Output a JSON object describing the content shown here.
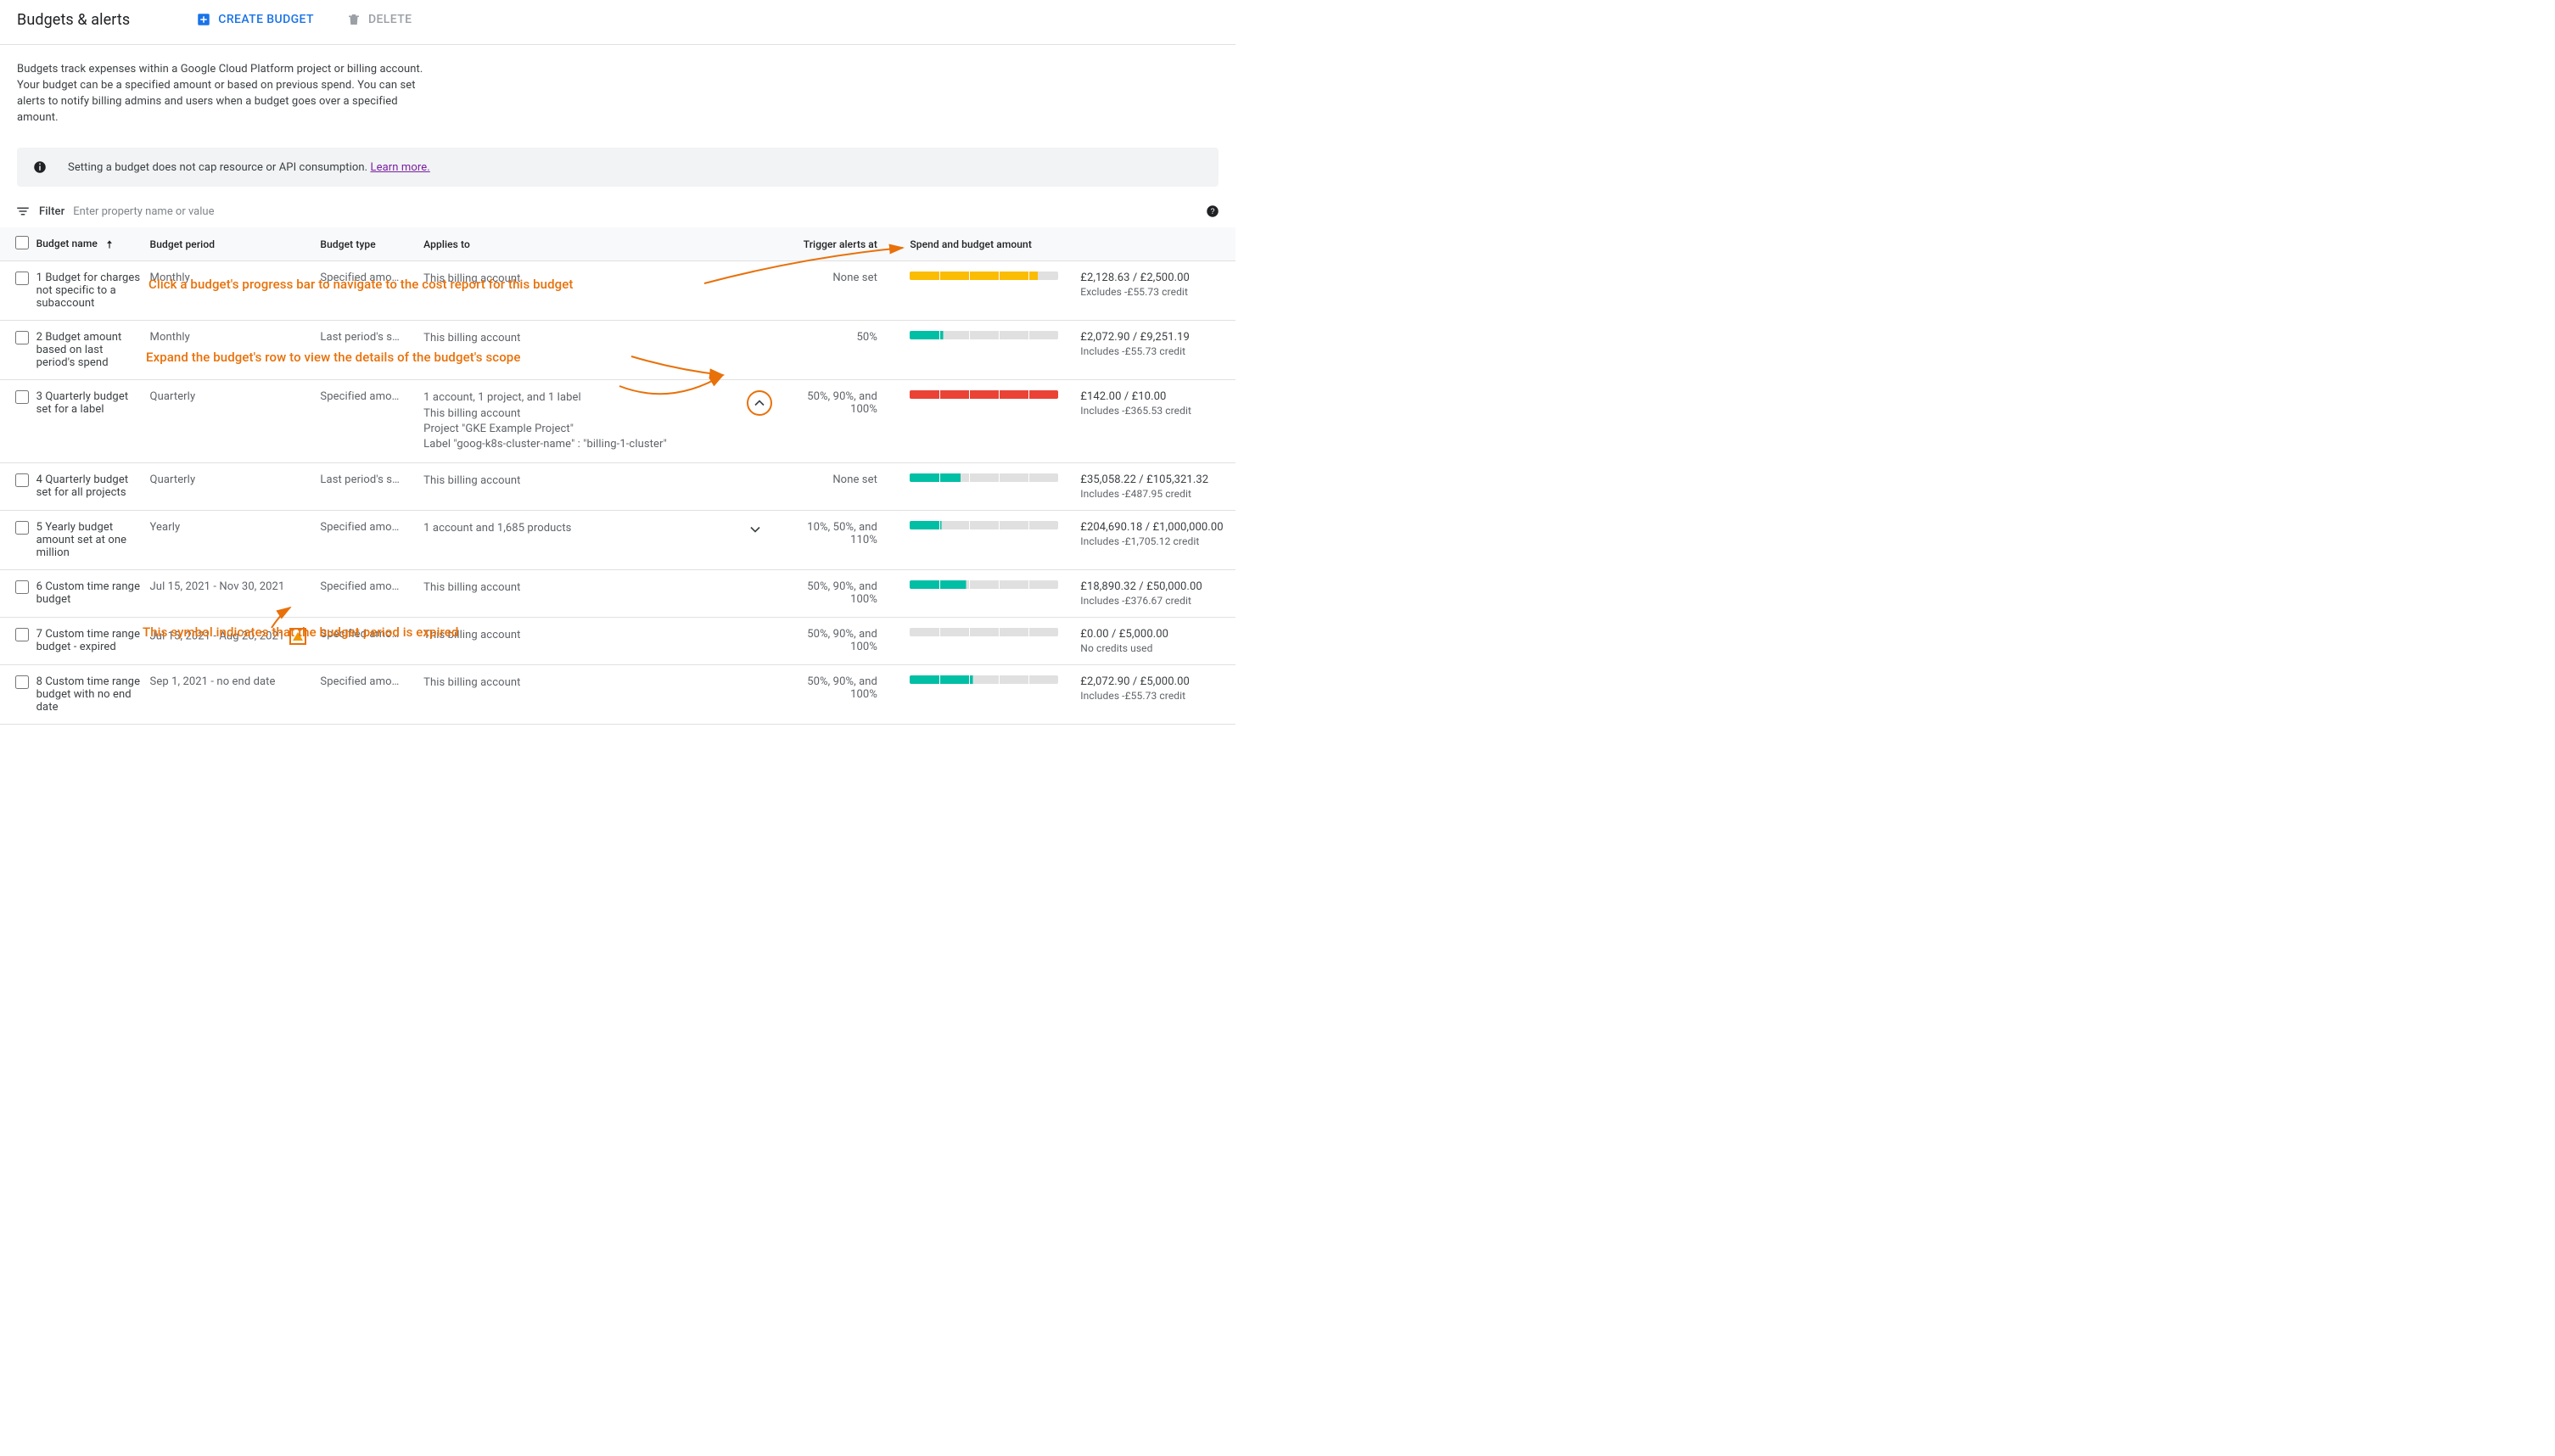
{
  "header": {
    "title": "Budgets & alerts",
    "create_label": "Create budget",
    "delete_label": "Delete"
  },
  "intro": "Budgets track expenses within a Google Cloud Platform project or billing account. Your budget can be a specified amount or based on previous spend. You can set alerts to notify billing admins and users when a budget goes over a specified amount.",
  "notice": {
    "text": "Setting a budget does not cap resource or API consumption. ",
    "link_label": "Learn more."
  },
  "filter": {
    "label": "Filter",
    "placeholder": "Enter property name or value"
  },
  "columns": {
    "name": "Budget name",
    "period": "Budget period",
    "type": "Budget type",
    "applies": "Applies to",
    "trigger": "Trigger alerts at",
    "spend": "Spend and budget amount"
  },
  "annotations": {
    "a1": "Click a budget's progress bar to navigate to the cost report for this budget",
    "a2": "Expand the budget's row to view the details of the budget's scope",
    "a3": "This symbol indicates that the budget period is expired"
  },
  "rows": [
    {
      "idx": "1",
      "name": "Budget for charges not specific to a subaccount",
      "period": "Monthly",
      "type": "Specified amo…",
      "applies": [
        "This billing account"
      ],
      "trigger": "None set",
      "expand": "none",
      "progress": {
        "segments": 5,
        "filled": 4,
        "partial": 0.3,
        "color": "fill-orange"
      },
      "amount": "£2,128.63 / £2,500.00",
      "sub": "Excludes -£55.73 credit"
    },
    {
      "idx": "2",
      "name": "Budget amount based on last period's spend",
      "period": "Monthly",
      "type": "Last period's s…",
      "applies": [
        "This billing account"
      ],
      "trigger": "50%",
      "expand": "none",
      "progress": {
        "segments": 5,
        "filled": 1,
        "partial": 0.1,
        "color": "fill-teal"
      },
      "amount": "£2,072.90 / £9,251.19",
      "sub": "Includes -£55.73 credit"
    },
    {
      "idx": "3",
      "name": "Quarterly budget set for a label",
      "period": "Quarterly",
      "type": "Specified amo…",
      "applies": [
        "1 account, 1 project, and 1 label",
        "This billing account",
        "Project \"GKE Example Project\"",
        "Label \"goog-k8s-cluster-name\" : \"billing-1-cluster\""
      ],
      "trigger": "50%, 90%, and 100%",
      "expand": "up-highlight",
      "progress": {
        "segments": 5,
        "filled": 5,
        "partial": 0,
        "color": "fill-red"
      },
      "amount": "£142.00 / £10.00",
      "sub": "Includes -£365.53 credit"
    },
    {
      "idx": "4",
      "name": "Quarterly budget set for all projects",
      "period": "Quarterly",
      "type": "Last period's s…",
      "applies": [
        "This billing account"
      ],
      "trigger": "None set",
      "expand": "none",
      "progress": {
        "segments": 5,
        "filled": 1,
        "partial": 0.7,
        "color": "fill-teal"
      },
      "amount": "£35,058.22 / £105,321.32",
      "sub": "Includes -£487.95 credit"
    },
    {
      "idx": "5",
      "name": "Yearly budget amount set at one million",
      "period": "Yearly",
      "type": "Specified amo…",
      "applies": [
        "1 account and 1,685 products"
      ],
      "trigger": "10%, 50%, and 110%",
      "expand": "down",
      "progress": {
        "segments": 5,
        "filled": 1,
        "partial": 0.05,
        "color": "fill-teal"
      },
      "amount": "£204,690.18 / £1,000,000.00",
      "sub": "Includes -£1,705.12 credit"
    },
    {
      "idx": "6",
      "name": "Custom time range budget",
      "period": "Jul 15, 2021 - Nov 30, 2021",
      "type": "Specified amo…",
      "applies": [
        "This billing account"
      ],
      "trigger": "50%, 90%, and 100%",
      "expand": "none",
      "progress": {
        "segments": 5,
        "filled": 1,
        "partial": 0.9,
        "color": "fill-teal"
      },
      "amount": "£18,890.32 / £50,000.00",
      "sub": "Includes -£376.67 credit"
    },
    {
      "idx": "7",
      "name": "Custom time range budget - expired",
      "period": "Jul 15, 2021 - Aug 20, 2021",
      "period_expired": true,
      "type": "Specified amo…",
      "applies": [
        "This billing account"
      ],
      "trigger": "50%, 90%, and 100%",
      "expand": "none",
      "progress": {
        "segments": 5,
        "filled": 0,
        "partial": 0,
        "color": "fill-teal"
      },
      "amount": "£0.00 / £5,000.00",
      "sub": "No credits used"
    },
    {
      "idx": "8",
      "name": "Custom time range budget with no end date",
      "period": "Sep 1, 2021 - no end date",
      "type": "Specified amo…",
      "applies": [
        "This billing account"
      ],
      "trigger": "50%, 90%, and 100%",
      "expand": "none",
      "progress": {
        "segments": 5,
        "filled": 2,
        "partial": 0.1,
        "color": "fill-teal"
      },
      "amount": "£2,072.90 / £5,000.00",
      "sub": "Includes -£55.73 credit"
    }
  ]
}
